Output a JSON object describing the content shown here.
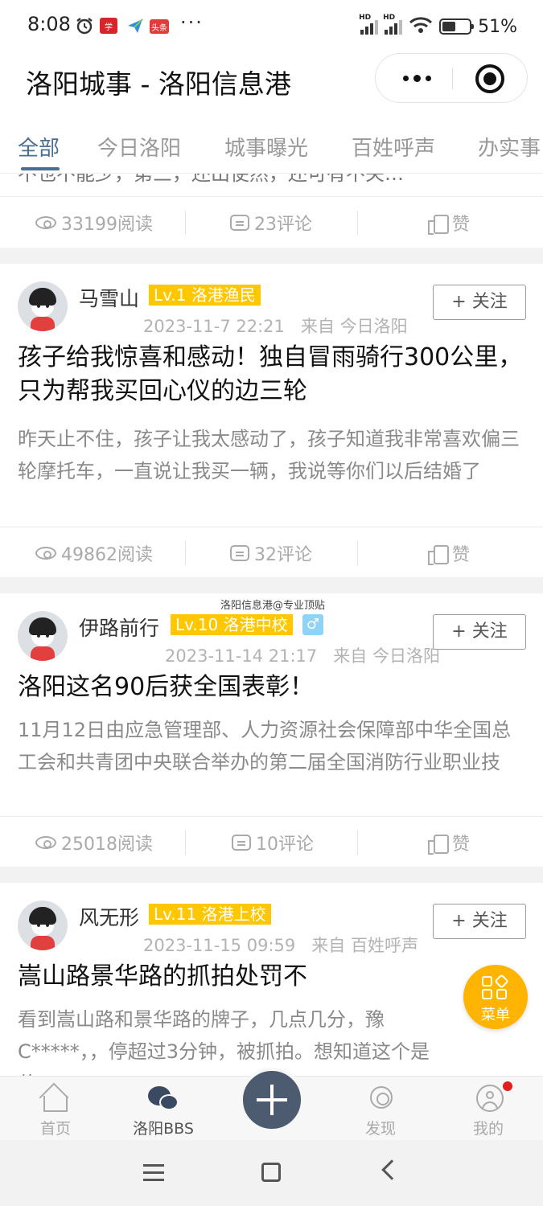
{
  "status_bar": {
    "time": "8:08",
    "app_icon_1": "学",
    "app_icon_3": "头条",
    "more": "···",
    "battery_percent": "51%",
    "battery_level": 0.51,
    "icons": [
      "alarm-icon",
      "app-icon",
      "paper-plane-icon",
      "toutiao-icon",
      "hd-signal-icon",
      "hd-signal-icon",
      "wifi-icon",
      "battery-icon"
    ]
  },
  "header": {
    "title": "洛阳城事 - 洛阳信息港"
  },
  "tabs": [
    {
      "label": "全部",
      "active": true
    },
    {
      "label": "今日洛阳"
    },
    {
      "label": "城事曝光"
    },
    {
      "label": "百姓呼声"
    },
    {
      "label": "办实事"
    }
  ],
  "feed": {
    "partial_text": "不也不能少，第三，还出使然，还可有不关…",
    "partial_stats": {
      "views": "33199阅读",
      "comments": "23评论",
      "like": "赞"
    },
    "posts": [
      {
        "author": "马雪山",
        "level": "Lv.1 洛港渔民",
        "time": "2023-11-7 22:21",
        "from": "来自 今日洛阳",
        "follow": "+ 关注",
        "title": "孩子给我惊喜和感动！独自冒雨骑行300公里，只为帮我买回心仪的边三轮",
        "excerpt": "昨天止不住，孩子让我太感动了，孩子知道我非常喜欢偏三轮摩托车，一直说让我买一辆，我说等你们以后结婚了",
        "views": "49862阅读",
        "comments": "32评论",
        "like": "赞"
      },
      {
        "author": "伊路前行",
        "level": "Lv.10 洛港中校",
        "gender": "♂",
        "time": "2023-11-14 21:17",
        "from": "来自 今日洛阳",
        "follow": "+ 关注",
        "title": "洛阳这名90后获全国表彰！",
        "excerpt": "11月12日由应急管理部、人力资源社会保障部中华全国总工会和共青团中央联合举办的第二届全国消防行业职业技",
        "views": "25018阅读",
        "comments": "10评论",
        "like": "赞"
      },
      {
        "author": "风无形",
        "level": "Lv.11 洛港上校",
        "time": "2023-11-15 09:59",
        "from": "来自 百姓呼声",
        "follow": "+ 关注",
        "title": "嵩山路景华路的抓拍处罚不",
        "excerpt": "看到嵩山路和景华路的牌子，几点几分，豫C*****，，停超过3分钟，被抓拍。想知道这个是什"
      }
    ]
  },
  "watermark": "洛阳信息港@专业顶贴",
  "fab_menu": "菜单",
  "bottom_nav": [
    {
      "label": "首页",
      "icon": "home-icon"
    },
    {
      "label": "洛阳BBS",
      "icon": "chat-bubbles-icon",
      "active": true
    },
    {
      "label": "发现",
      "icon": "discover-icon"
    },
    {
      "label": "我的",
      "icon": "user-icon",
      "badge": true
    }
  ],
  "colors": {
    "accent": "#4a6d92",
    "level_badge": "#ffc700",
    "fab_menu": "#ffb400",
    "fab_add": "#4d5b70"
  }
}
